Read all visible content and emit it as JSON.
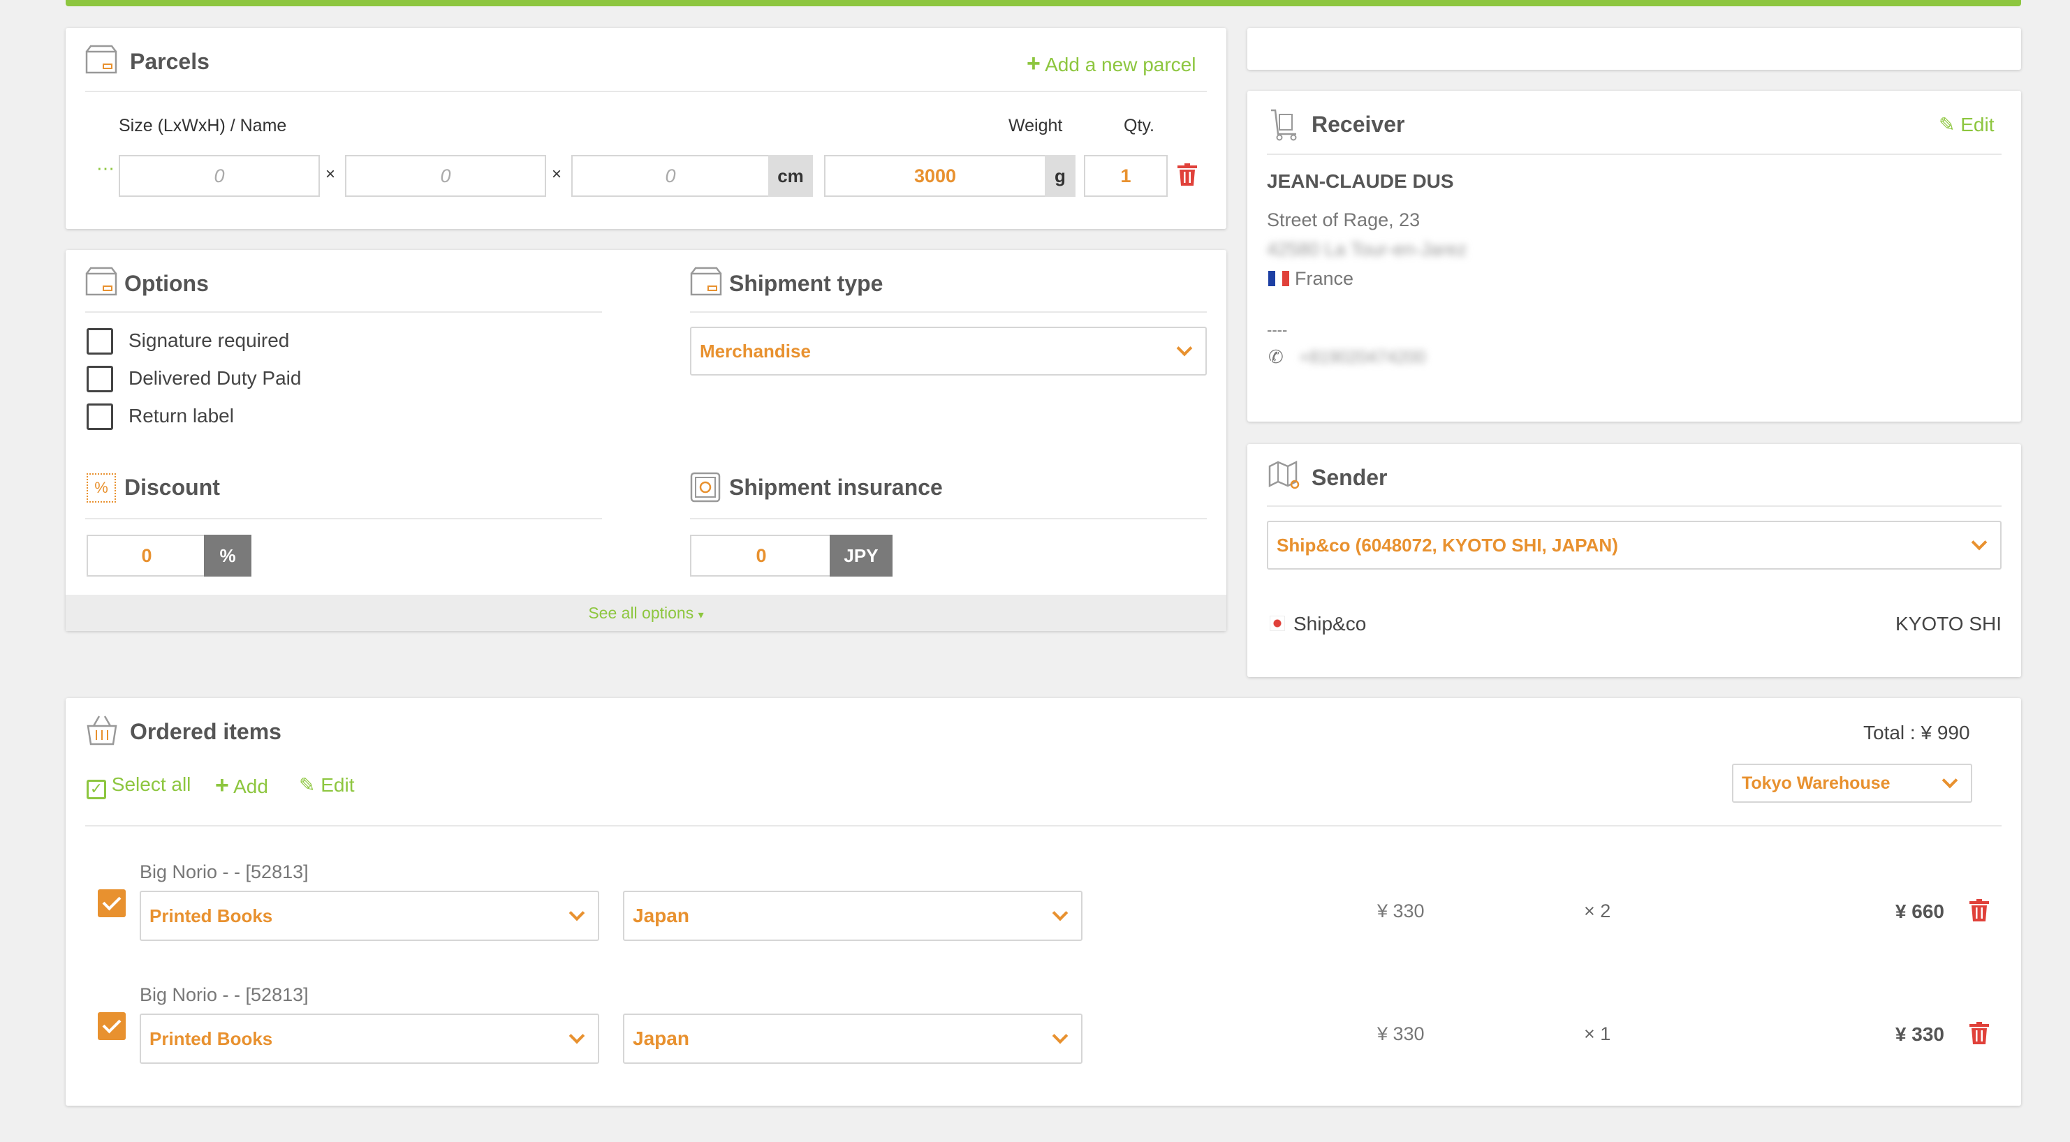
{
  "parcels": {
    "title": "Parcels",
    "add_label": "Add a new parcel",
    "col_size": "Size (LxWxH) / Name",
    "col_weight": "Weight",
    "col_qty": "Qty.",
    "length": "0",
    "width": "0",
    "height": "0",
    "times": "×",
    "size_unit": "cm",
    "weight": "3000",
    "weight_unit": "g",
    "qty": "1"
  },
  "options": {
    "title": "Options",
    "items": [
      "Signature required",
      "Delivered Duty Paid",
      "Return label"
    ],
    "discount_title": "Discount",
    "discount_value": "0",
    "discount_unit": "%",
    "see_all": "See all options"
  },
  "shipment_type": {
    "title": "Shipment type",
    "selected": "Merchandise"
  },
  "insurance": {
    "title": "Shipment insurance",
    "value": "0",
    "currency": "JPY"
  },
  "receiver": {
    "title": "Receiver",
    "edit_label": "Edit",
    "name": "JEAN-CLAUDE DUS",
    "street": "Street of Rage, 23",
    "city": "42580 La Tour-en-Jarez",
    "country": "France",
    "separator": "----",
    "phone": "+819020474200"
  },
  "sender": {
    "title": "Sender",
    "selected": "Ship&co (6048072, KYOTO SHI, JAPAN)",
    "name": "Ship&co",
    "city": "KYOTO SHI"
  },
  "ordered_items": {
    "title": "Ordered items",
    "total": "Total : ¥ 990",
    "select_all": "Select all",
    "add": "Add",
    "edit": "Edit",
    "warehouse": "Tokyo Warehouse",
    "items": [
      {
        "name": "Big Norio - - [52813]",
        "category": "Printed Books",
        "origin": "Japan",
        "price": "¥ 330",
        "qty": "× 2",
        "total": "¥ 660"
      },
      {
        "name": "Big Norio - - [52813]",
        "category": "Printed Books",
        "origin": "Japan",
        "price": "¥ 330",
        "qty": "× 1",
        "total": "¥ 330"
      }
    ]
  },
  "colors": {
    "accent": "#8dc63f",
    "orange": "#e8912f",
    "danger": "#e0413a",
    "background": "#f0f0f0"
  },
  "icons": [
    "box-icon",
    "plus-icon",
    "trash-icon",
    "discount-icon",
    "safe-icon",
    "trolley-icon",
    "pencil-icon",
    "map-icon",
    "flag-fr-icon",
    "flag-jp-icon",
    "phone-icon",
    "basket-icon",
    "checkbox-icon",
    "chevron-down-icon"
  ]
}
